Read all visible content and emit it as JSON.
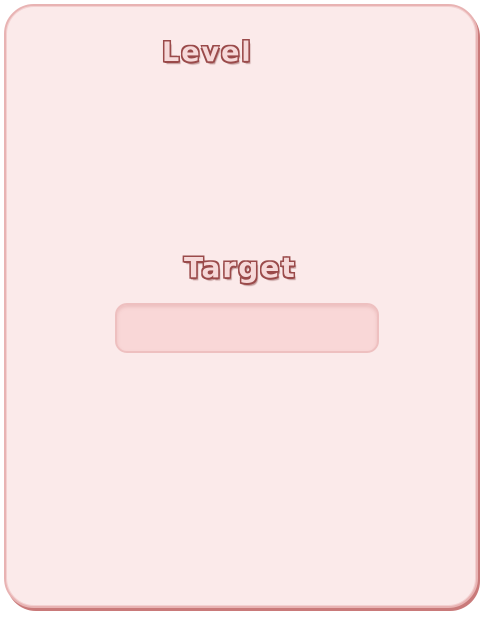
{
  "panel": {
    "level_label": "Level",
    "target_label": "Target",
    "target_value": ""
  },
  "colors": {
    "panel_bg": "#fbeaea",
    "panel_border": "#c97a7a",
    "title_fill": "#f6d9d9",
    "title_outline": "#9a4a4a",
    "slot_bg": "#f9d7d7"
  }
}
